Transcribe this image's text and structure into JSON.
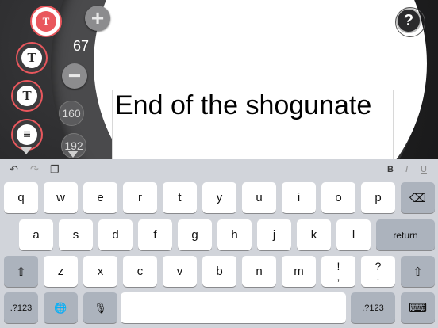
{
  "canvas": {
    "text": "End of the shogunate"
  },
  "toolbar": {
    "tool_1_glyph": "T",
    "tool_2_glyph": "T",
    "tool_3_glyph": "T",
    "tool_4_glyph": "≡",
    "plus_label": "+",
    "minus_label": "−",
    "size_value": "67",
    "preset_1": "160",
    "preset_2": "192",
    "help_label": "?"
  },
  "keyboard": {
    "toolbar": {
      "undo": "↶",
      "redo": "↷",
      "paste": "❐",
      "bold": "B",
      "italic": "I",
      "underline": "U"
    },
    "row1": [
      "q",
      "w",
      "e",
      "r",
      "t",
      "y",
      "u",
      "i",
      "o",
      "p"
    ],
    "row2": [
      "a",
      "s",
      "d",
      "f",
      "g",
      "h",
      "j",
      "k",
      "l"
    ],
    "row3": [
      "z",
      "x",
      "c",
      "v",
      "b",
      "n",
      "m"
    ],
    "punct1": [
      "!",
      ","
    ],
    "punct2": [
      "?",
      "."
    ],
    "backspace": "⌫",
    "return_label": "return",
    "shift": "⇧",
    "numbers_label": ".?123",
    "globe": "🌐",
    "mic": "🎙",
    "hide": "⌨"
  }
}
